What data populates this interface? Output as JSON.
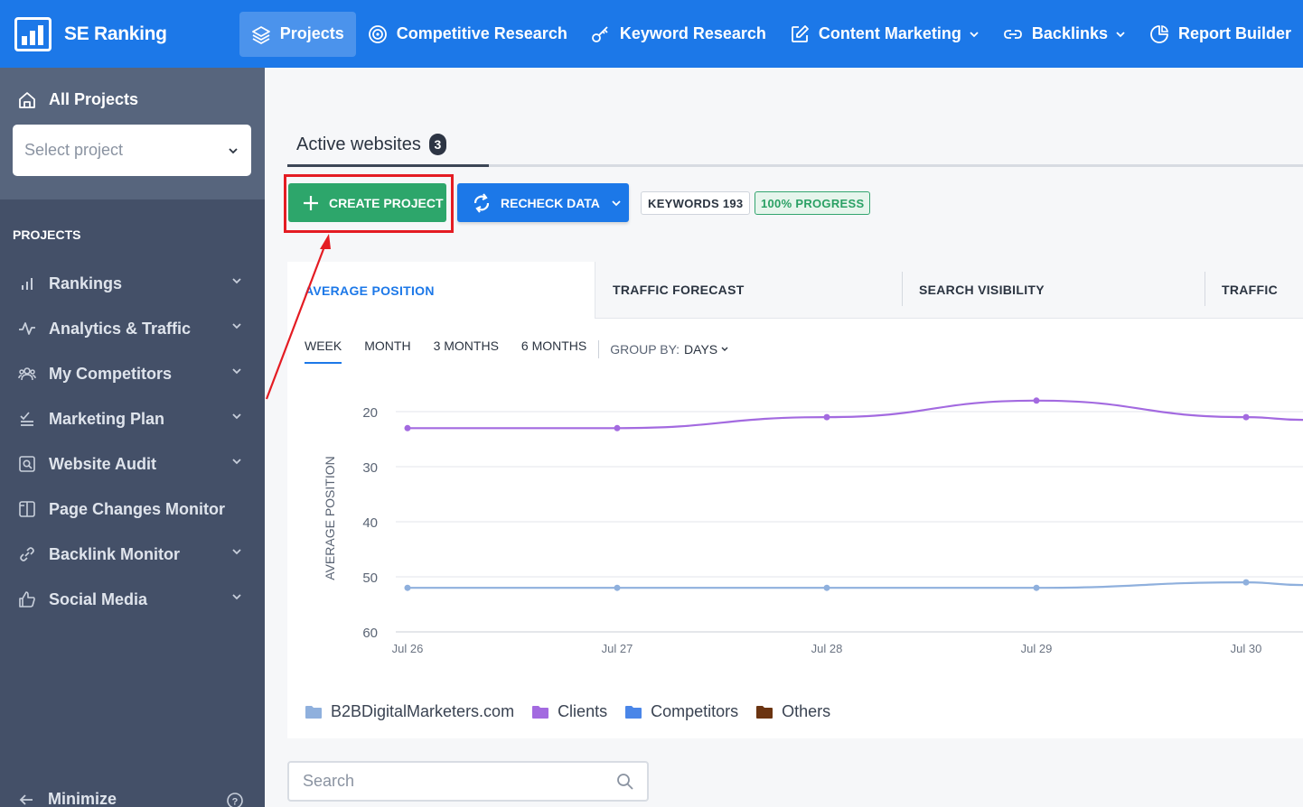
{
  "app": {
    "name": "SE Ranking"
  },
  "nav": [
    {
      "label": "Projects",
      "icon": "layers-icon",
      "active": true
    },
    {
      "label": "Competitive Research",
      "icon": "target-icon"
    },
    {
      "label": "Keyword Research",
      "icon": "key-icon"
    },
    {
      "label": "Content Marketing",
      "icon": "edit-icon",
      "dropdown": true
    },
    {
      "label": "Backlinks",
      "icon": "link-icon",
      "dropdown": true
    },
    {
      "label": "Report Builder",
      "icon": "pie-icon"
    }
  ],
  "sidebar": {
    "all_projects": "All Projects",
    "select_placeholder": "Select project",
    "heading": "PROJECTS",
    "items": [
      {
        "label": "Rankings",
        "icon": "bar-chart-icon"
      },
      {
        "label": "Analytics & Traffic",
        "icon": "pulse-icon"
      },
      {
        "label": "My Competitors",
        "icon": "users-icon"
      },
      {
        "label": "Marketing Plan",
        "icon": "checklist-icon"
      },
      {
        "label": "Website Audit",
        "icon": "audit-icon"
      },
      {
        "label": "Page Changes Monitor",
        "icon": "columns-icon"
      },
      {
        "label": "Backlink Monitor",
        "icon": "link-icon"
      },
      {
        "label": "Social Media",
        "icon": "thumbs-up-icon"
      }
    ],
    "minimize": "Minimize"
  },
  "main": {
    "active_websites": "Active websites",
    "active_count": "3",
    "create_project": "CREATE PROJECT",
    "recheck_data": "RECHECK DATA",
    "keywords": "KEYWORDS 193",
    "progress": "100%  PROGRESS",
    "tabs": [
      "AVERAGE POSITION",
      "TRAFFIC FORECAST",
      "SEARCH VISIBILITY",
      "TRAFFIC"
    ],
    "periods": [
      "WEEK",
      "MONTH",
      "3 MONTHS",
      "6 MONTHS"
    ],
    "group_by_label": "GROUP BY:",
    "group_by_value": "DAYS",
    "legend": [
      {
        "label": "B2BDigitalMarketers.com",
        "color": "#8fb0dd"
      },
      {
        "label": "Clients",
        "color": "#a36ae0"
      },
      {
        "label": "Competitors",
        "color": "#4a86e8"
      },
      {
        "label": "Others",
        "color": "#6b3411"
      }
    ],
    "search_placeholder": "Search"
  },
  "chart_data": {
    "type": "line",
    "ylabel": "AVERAGE POSITION",
    "x": [
      "Jul 26",
      "Jul 27",
      "Jul 28",
      "Jul 29",
      "Jul 30"
    ],
    "yticks": [
      20,
      30,
      40,
      50,
      60
    ],
    "ylim": [
      60,
      20
    ],
    "inverted_y": true,
    "series": [
      {
        "name": "Clients",
        "color": "#a36ae0",
        "values": [
          23,
          23,
          21,
          18,
          21
        ]
      },
      {
        "name": "B2BDigitalMarketers.com",
        "color": "#8fb0dd",
        "values": [
          52,
          52,
          52,
          52,
          51
        ]
      }
    ]
  }
}
